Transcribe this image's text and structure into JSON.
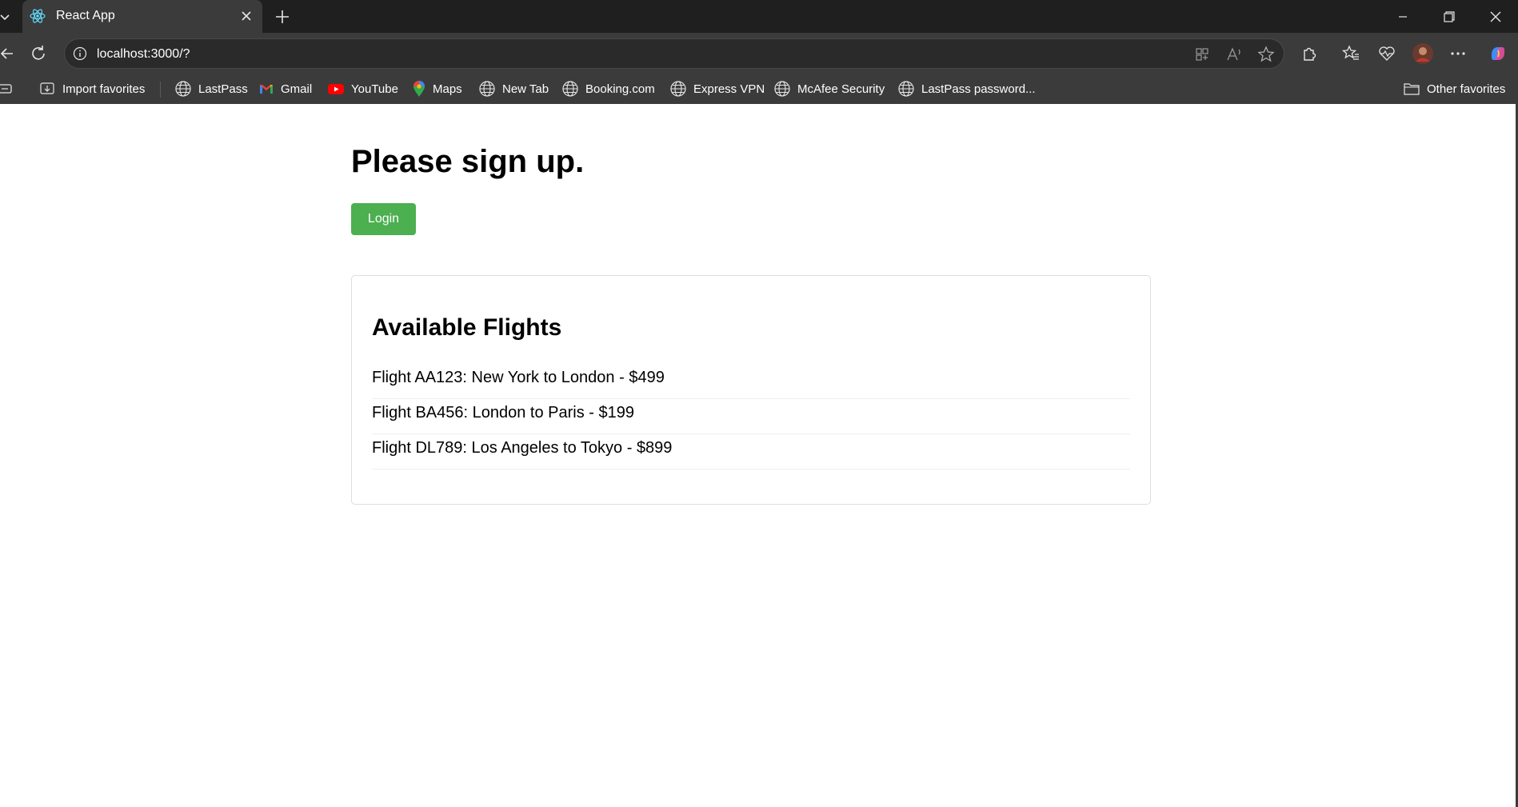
{
  "browser": {
    "tab_title": "React App",
    "url": "localhost:3000/?"
  },
  "bookmarks": {
    "items": [
      {
        "label": "Import favorites",
        "icon": "import-favorites-icon"
      },
      {
        "label": "LastPass",
        "icon": "globe-icon"
      },
      {
        "label": "Gmail",
        "icon": "gmail-icon"
      },
      {
        "label": "YouTube",
        "icon": "youtube-icon"
      },
      {
        "label": "Maps",
        "icon": "maps-icon"
      },
      {
        "label": "New Tab",
        "icon": "globe-icon"
      },
      {
        "label": "Booking.com",
        "icon": "globe-icon"
      },
      {
        "label": "Express VPN",
        "icon": "globe-icon"
      },
      {
        "label": "McAfee Security",
        "icon": "globe-icon"
      },
      {
        "label": "LastPass password...",
        "icon": "globe-icon"
      }
    ],
    "other_favorites": "Other favorites"
  },
  "page": {
    "title": "Please sign up.",
    "login_label": "Login",
    "flights_heading": "Available Flights",
    "flights": [
      "Flight AA123: New York to London - $499",
      "Flight BA456: London to Paris - $199",
      "Flight DL789: Los Angeles to Tokyo - $899"
    ]
  },
  "colors": {
    "login_button": "#4caf50",
    "browser_chrome": "#3b3b3b",
    "titlebar": "#1f1f1f"
  }
}
